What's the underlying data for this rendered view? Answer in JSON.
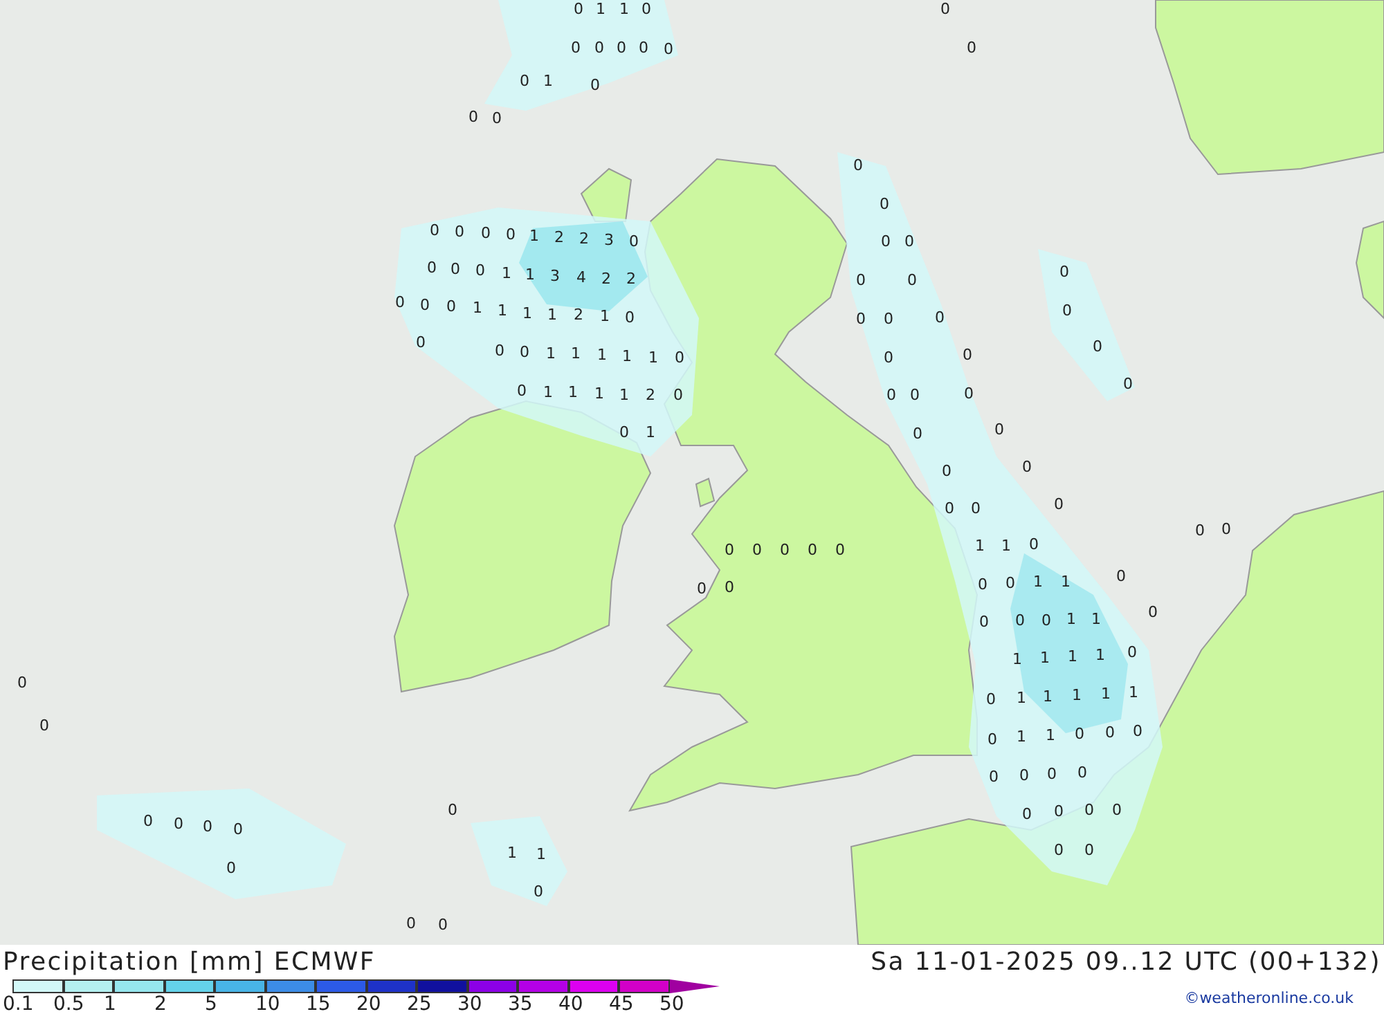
{
  "map": {
    "values": [
      "0",
      "1",
      "1",
      "0",
      "0",
      "0",
      "0",
      "0",
      "0",
      "0",
      "0",
      "0",
      "1",
      "0",
      "0",
      "0",
      "0",
      "0",
      "0",
      "0",
      "0",
      "0",
      "1",
      "2",
      "2",
      "3",
      "0",
      "0",
      "0",
      "0",
      "0",
      "0",
      "1",
      "1",
      "3",
      "4",
      "2",
      "2",
      "0",
      "0",
      "0",
      "0",
      "0",
      "0",
      "1",
      "1",
      "1",
      "1",
      "2",
      "1",
      "0",
      "0",
      "0",
      "0",
      "0",
      "0",
      "0",
      "0",
      "1",
      "1",
      "1",
      "1",
      "1",
      "0",
      "0",
      "0",
      "0",
      "0",
      "0",
      "1",
      "1",
      "1",
      "1",
      "2",
      "0",
      "0",
      "0",
      "0",
      "0",
      "1",
      "0",
      "0",
      "0",
      "0",
      "0",
      "0",
      "0",
      "0",
      "0",
      "0",
      "0",
      "0",
      "0",
      "0",
      "1",
      "1",
      "0",
      "0",
      "0",
      "0",
      "0",
      "0",
      "1",
      "1",
      "0",
      "0",
      "0",
      "0",
      "1",
      "1",
      "0",
      "1",
      "1",
      "1",
      "1",
      "0",
      "0",
      "1",
      "1",
      "1",
      "1",
      "1",
      "0",
      "0",
      "1",
      "1",
      "0",
      "0",
      "0",
      "0",
      "0",
      "0",
      "0",
      "0",
      "0",
      "0",
      "0",
      "0",
      "0",
      "0",
      "0",
      "0",
      "1",
      "1",
      "0",
      "0",
      "0",
      "0",
      "0",
      "0"
    ]
  },
  "footer": {
    "title": "Precipitation [mm] ECMWF",
    "valid_time": "Sa 11-01-2025 09..12 UTC (00+132)",
    "credit": "©weatheronline.co.uk",
    "legend": [
      {
        "label": "0.1",
        "color": "#d2f8f8"
      },
      {
        "label": "0.5",
        "color": "#b4f0f0"
      },
      {
        "label": "1",
        "color": "#96e6ee"
      },
      {
        "label": "2",
        "color": "#64d2ea"
      },
      {
        "label": "5",
        "color": "#48b4e6"
      },
      {
        "label": "10",
        "color": "#3c8ce6"
      },
      {
        "label": "15",
        "color": "#2c5ae6"
      },
      {
        "label": "20",
        "color": "#1e32c8"
      },
      {
        "label": "25",
        "color": "#10109e"
      },
      {
        "label": "30",
        "color": "#8c00e6"
      },
      {
        "label": "35",
        "color": "#b400e6"
      },
      {
        "label": "40",
        "color": "#dc00f0"
      },
      {
        "label": "45",
        "color": "#d200c8"
      },
      {
        "label": "50",
        "color": "#a000a0"
      }
    ]
  }
}
